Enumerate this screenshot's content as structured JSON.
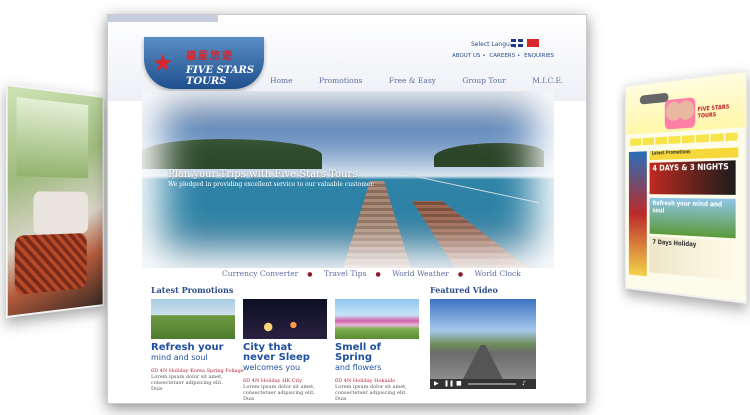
{
  "left_card": {
    "name": "left-photo-card"
  },
  "right_card": {
    "logo": "FIVE STARS TOURS",
    "promotions_label": "Latest Promotions",
    "banner1": "4 DAYS & 3 NIGHTS",
    "banner2": "Refresh your mind and soul",
    "banner3": "7 Days Holiday"
  },
  "header": {
    "logo_chinese": "福星旅遊",
    "logo_english": "FIVE STARS TOURS",
    "select_language": "Select Language",
    "top_links": [
      "ABOUT US",
      "CAREERS",
      "ENQUIRIES"
    ],
    "nav": [
      "Home",
      "Promotions",
      "Free & Easy",
      "Group Tour",
      "M.I.C.E."
    ]
  },
  "hero": {
    "title": "Plan your Trips with Five Stars Tours",
    "subtitle": "We pledged in providing excellent service to our valuable customer."
  },
  "subnav": [
    "Currency Converter",
    "Travel Tips",
    "World Weather",
    "World Clock"
  ],
  "promotions": {
    "title": "Latest Promotions",
    "items": [
      {
        "headline": "Refresh your",
        "headline2": "mind and soul",
        "caption": "6D 4N Holiday Korea Spring Foliage",
        "lorem1": "Lorem ipsum dolor sit amet,",
        "lorem2": "consectetuer adipiscing elit. Duis"
      },
      {
        "headline": "City that never Sleep",
        "headline2": "welcomes you",
        "caption": "6D 4N Holiday HK City",
        "lorem1": "Lorem ipsum dolor sit amet,",
        "lorem2": "consectetuer adipiscing elit. Duis"
      },
      {
        "headline": "Smell of Spring",
        "headline2": "and flowers",
        "caption": "6D 4N Holiday Hokaido",
        "lorem1": "Lorem ipsum dolor sit amet,",
        "lorem2": "consectetuer adipiscing elit. Duis"
      }
    ]
  },
  "video": {
    "title": "Featured Video"
  },
  "colors": {
    "brand_blue": "#2e4d8a",
    "accent_red": "#b2223a"
  }
}
